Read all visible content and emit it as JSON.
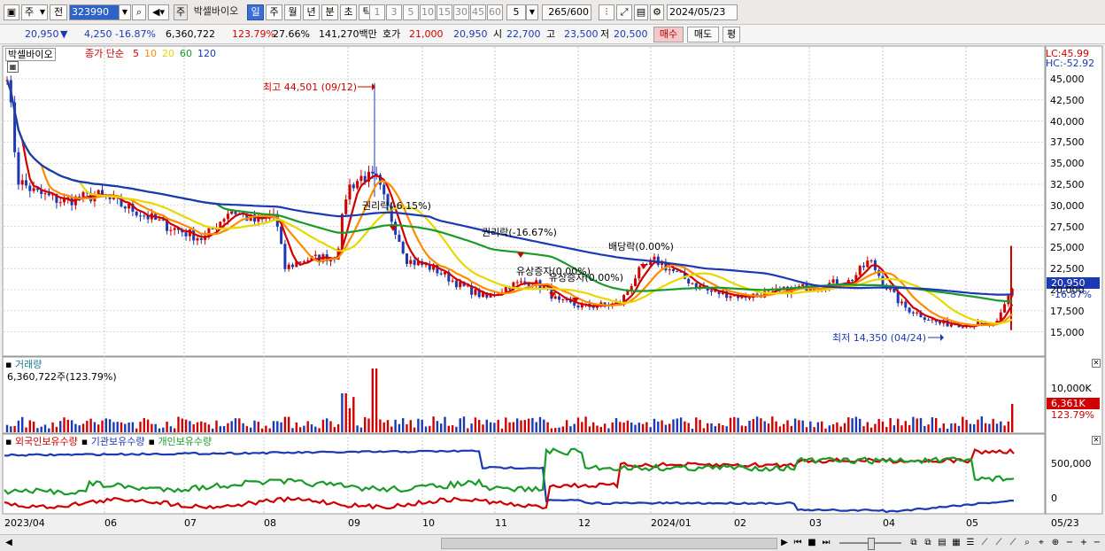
{
  "toolbar": {
    "type_label": "주",
    "prev_label": "전",
    "code_value": "323990",
    "stock_button": "주",
    "stock_name": "박셀바이오",
    "periods": [
      "일",
      "주",
      "월",
      "년",
      "분",
      "초",
      "틱"
    ],
    "period_selected": 0,
    "intervals": [
      "1",
      "3",
      "5",
      "10",
      "15",
      "30",
      "45",
      "60"
    ],
    "interval_value": "5",
    "count_value": "265",
    "count_max": "/600",
    "date_value": "2024/05/23"
  },
  "quote": {
    "price": "20,950",
    "change_arrow": "▼",
    "change": "4,250",
    "change_pct": "-16.87%",
    "volume": "6,360,722",
    "vol_ratio": "123.79%",
    "turnover": "27.66%",
    "amount": "141,270백만",
    "bid_label": "호가",
    "bid": "21,000",
    "ask": "20,950",
    "open_label": "시",
    "open": "22,700",
    "high_label": "고",
    "high": "23,500",
    "low_label": "저",
    "low": "20,500",
    "buy_button": "매수",
    "sell_button": "매도",
    "eval_button": "평"
  },
  "price_pane": {
    "stock_tag": "박셀바이오",
    "indicator_label": "종가 단순",
    "ma_periods": [
      {
        "label": "5",
        "color": "#d00000"
      },
      {
        "label": "10",
        "color": "#ff8c00"
      },
      {
        "label": "20",
        "color": "#e8d800"
      },
      {
        "label": "60",
        "color": "#1a9a2a"
      },
      {
        "label": "120",
        "color": "#1b39b4"
      }
    ],
    "lc_label": "LC:45.99",
    "hc_label": "HC:-52.92",
    "y_ticks": [
      "45,000",
      "42,500",
      "40,000",
      "37,500",
      "35,000",
      "32,500",
      "30,000",
      "27,500",
      "25,000",
      "22,500",
      "20,000",
      "17,500",
      "15,000"
    ],
    "current_price_tag": "20,950",
    "current_pct_tag": "-16.87%",
    "annotations": {
      "high": "최고 44,501 (09/12)",
      "low": "최저 14,350 (04/24)",
      "ex_right_1": "권리락(-6.15%)",
      "ex_right_2": "권리락(-16.67%)",
      "rights_1": "유상증자(0.00%)",
      "rights_2": "유상증자(0.00%)",
      "dividend": "배당락(0.00%)"
    }
  },
  "volume_pane": {
    "title": "거래량",
    "value": "6,360,722주(123.79%)",
    "y_tick": "10,000K",
    "tag_value": "6,361K",
    "tag_pct": "123.79%"
  },
  "holding_pane": {
    "series": [
      {
        "label": "외국인보유수량",
        "color": "#d00000"
      },
      {
        "label": "기관보유수량",
        "color": "#1b39b4"
      },
      {
        "label": "개인보유수량",
        "color": "#1a9a2a"
      }
    ],
    "y_ticks": [
      "500,000",
      "0"
    ]
  },
  "x_axis": [
    "2023/04",
    "06",
    "07",
    "08",
    "09",
    "10",
    "11",
    "12",
    "2024/01",
    "02",
    "03",
    "04",
    "05"
  ],
  "x_right_label": "05/23",
  "colors": {
    "up": "#d00000",
    "down": "#1b39b4",
    "panel_bg": "#ffffff",
    "grid": "#c8c8c8"
  }
}
